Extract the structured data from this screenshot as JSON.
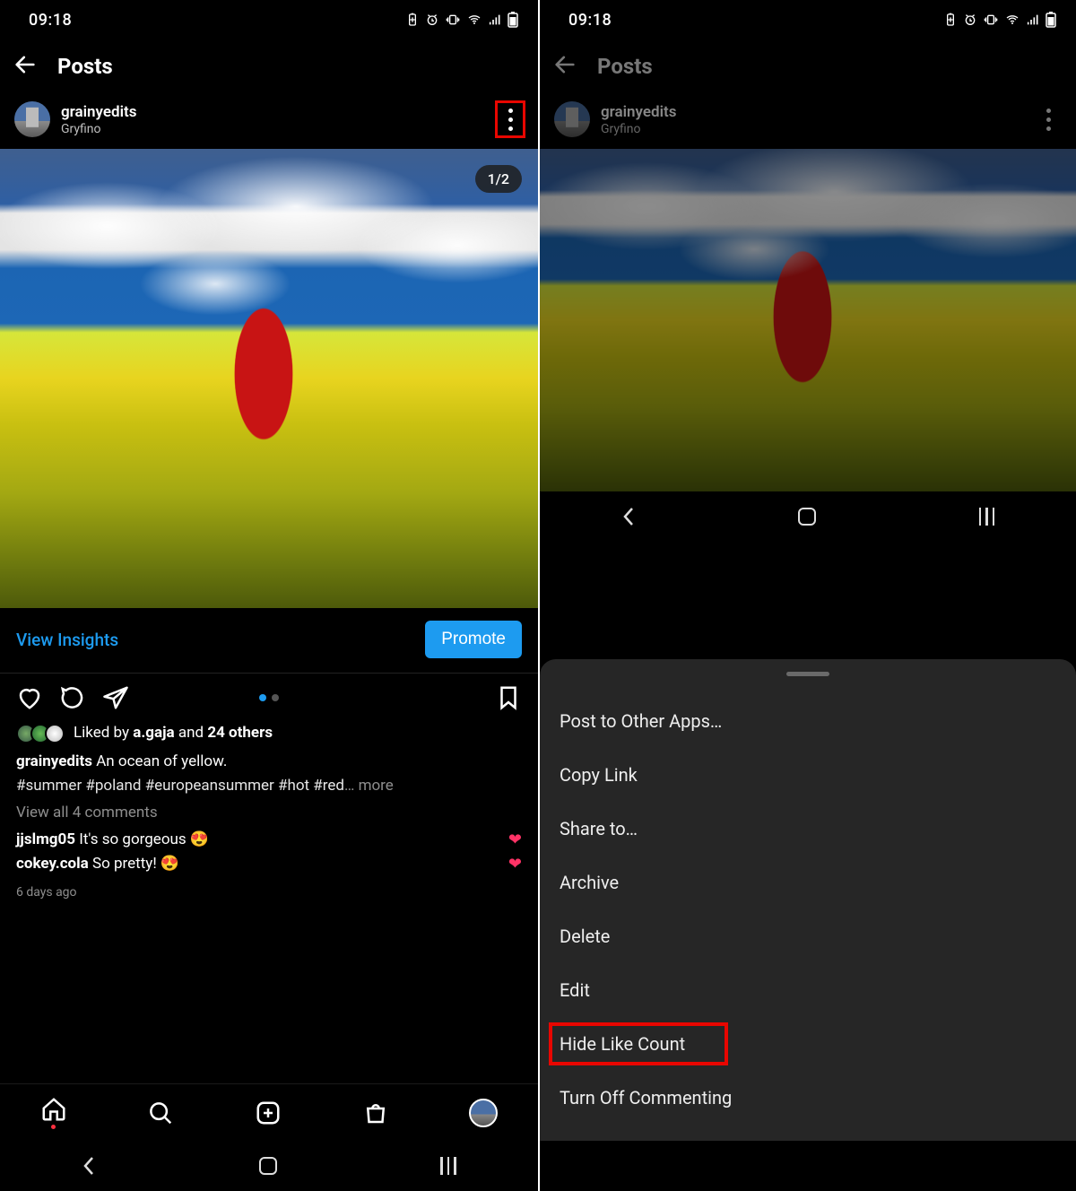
{
  "status": {
    "time": "09:18"
  },
  "header": {
    "title": "Posts"
  },
  "post": {
    "username": "grainyedits",
    "location": "Gryfino",
    "carousel_index": "1/2"
  },
  "insights": {
    "view_label": "View Insights",
    "promote_label": "Promote"
  },
  "likes": {
    "prefix": "Liked by ",
    "liker": "a.gaja",
    "and": " and ",
    "others": "24 others"
  },
  "caption": {
    "author": "grainyedits",
    "text": " An ocean of yellow.",
    "hashtags": "#summer #poland #europeansummer #hot #red",
    "ellipsis": "… ",
    "more": "more"
  },
  "comments": {
    "view_all": "View all 4 comments",
    "c1_user": "jjslmg05",
    "c1_text": " It's so gorgeous 😍",
    "c2_user": "cokey.cola",
    "c2_text": " So pretty! 😍"
  },
  "timestamp": "6 days ago",
  "sheet": {
    "items": [
      "Post to Other Apps…",
      "Copy Link",
      "Share to…",
      "Archive",
      "Delete",
      "Edit",
      "Hide Like Count",
      "Turn Off Commenting"
    ]
  }
}
